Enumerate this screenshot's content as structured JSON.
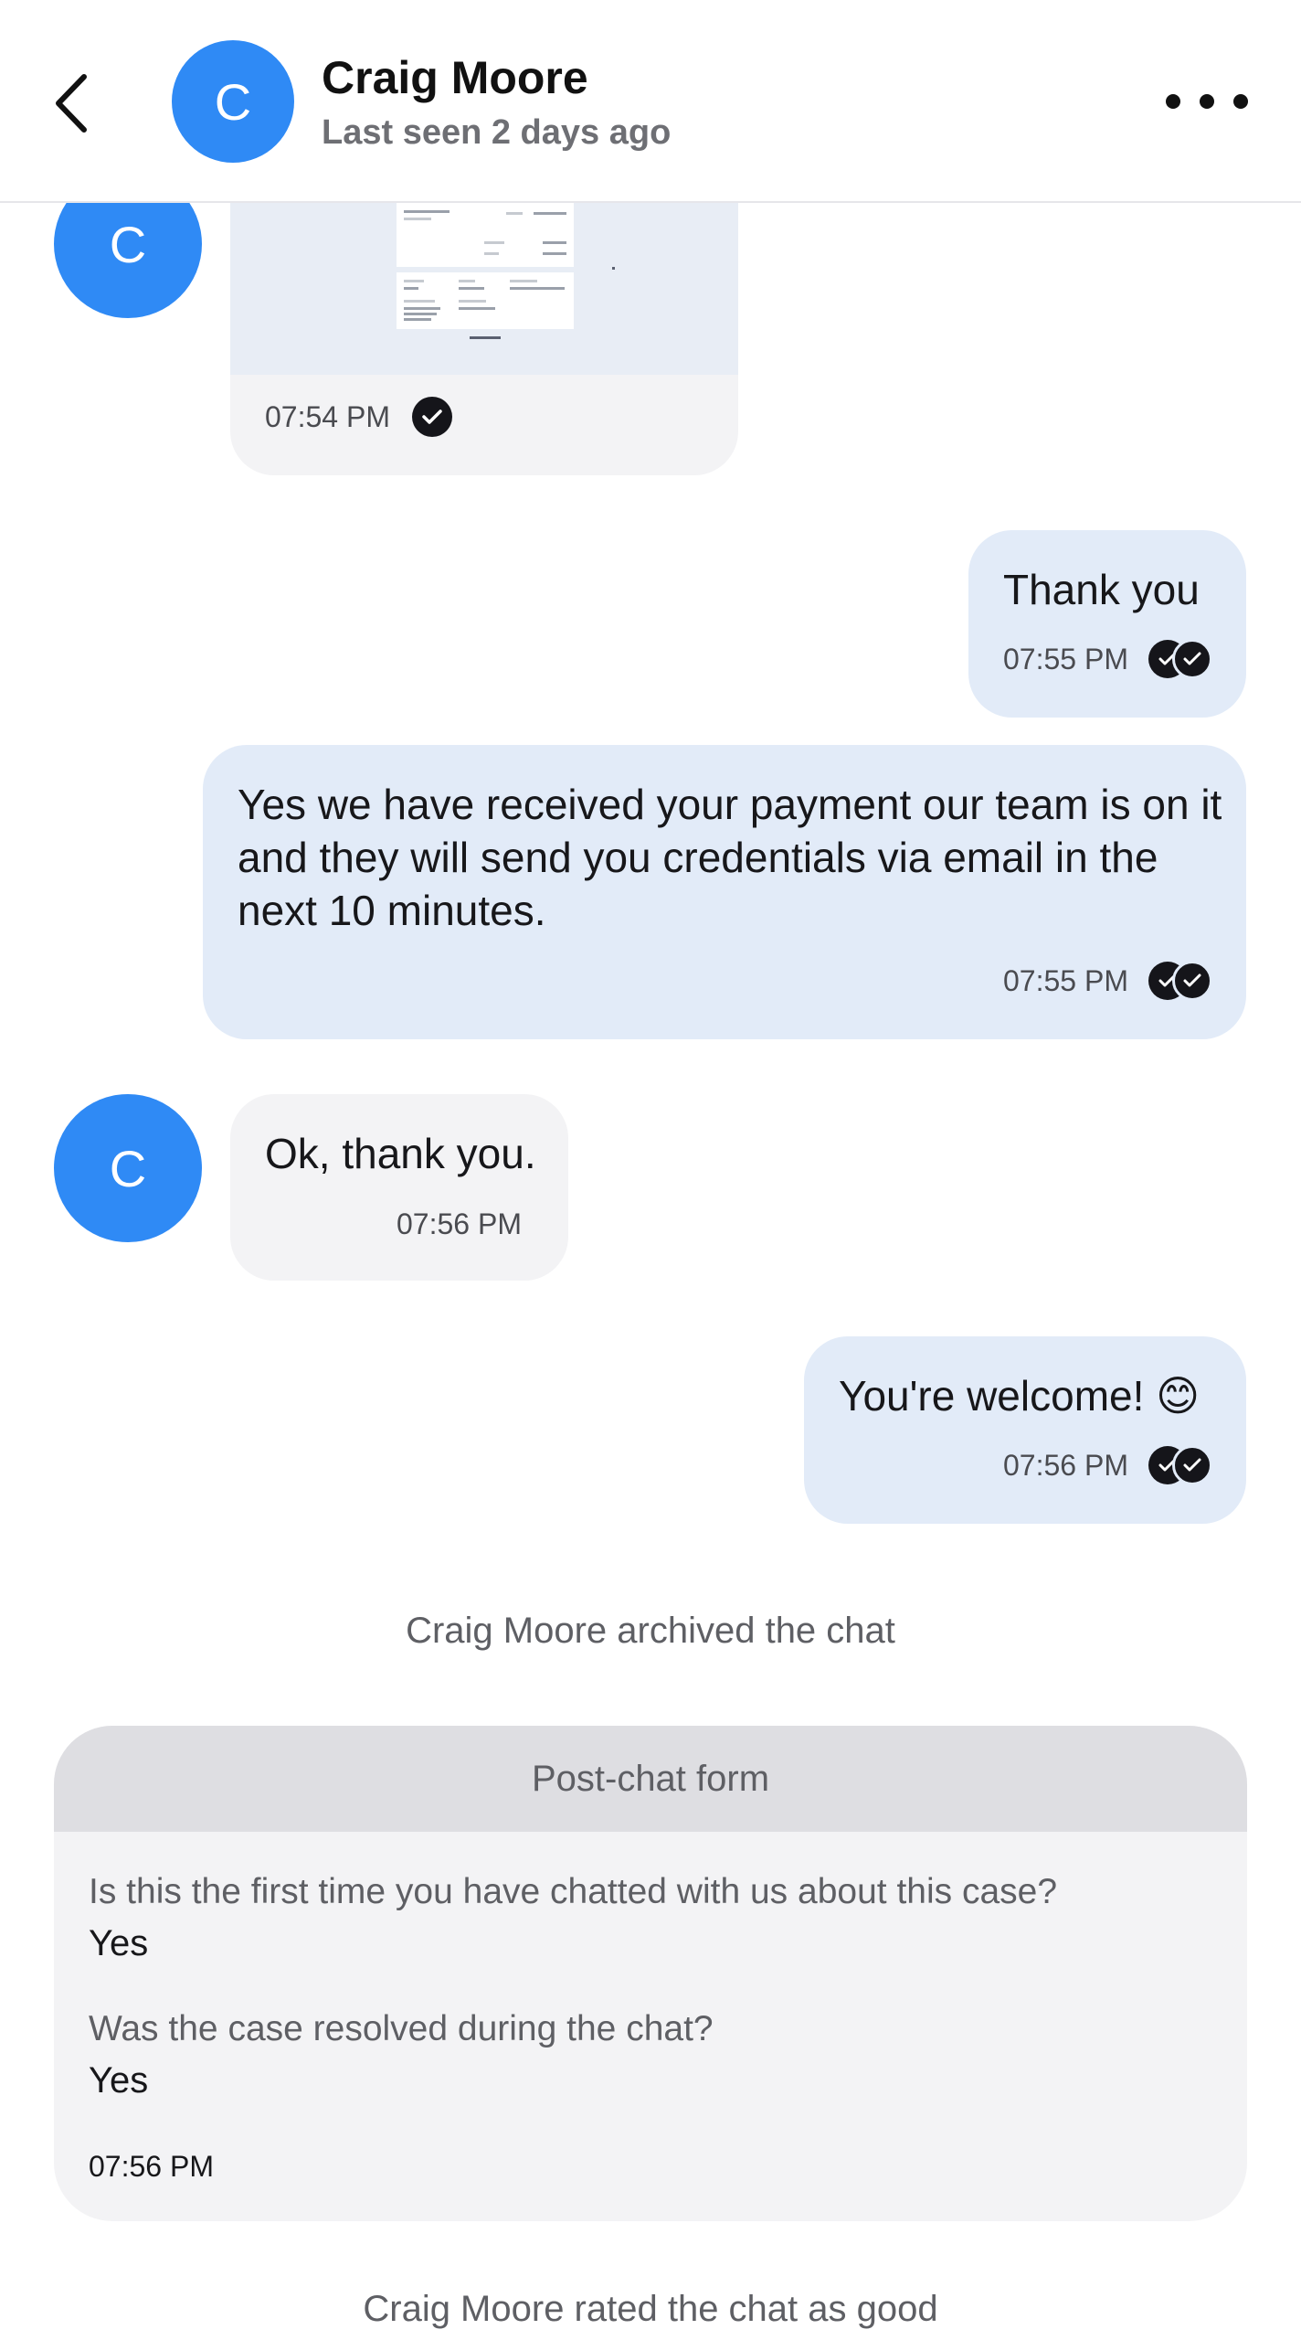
{
  "header": {
    "contact_name": "Craig Moore",
    "contact_status": "Last seen 2 days ago",
    "avatar_initial": "C",
    "back_icon": "chevron-left-icon",
    "more_icon": "more-horizontal-icon"
  },
  "colors": {
    "avatar": "#2f8af5",
    "outgoing_bubble": "#e2ebf8",
    "incoming_bubble": "#f3f3f5"
  },
  "messages": [
    {
      "direction": "in",
      "type": "attachment",
      "time": "07:54 PM",
      "status": "sent"
    },
    {
      "direction": "out",
      "text": "Thank you",
      "time": "07:55 PM",
      "status": "read"
    },
    {
      "direction": "out",
      "text": "Yes we have received your payment our team is on it and they will send you credentials via email in the next 10 minutes.",
      "time": "07:55 PM",
      "status": "read"
    },
    {
      "direction": "in",
      "text": "Ok, thank you.",
      "time": "07:56 PM"
    },
    {
      "direction": "out",
      "text": "You're welcome! 😊",
      "time": "07:56 PM",
      "status": "read"
    }
  ],
  "system": {
    "archived": "Craig Moore archived the chat",
    "rated": "Craig Moore rated the chat as good"
  },
  "post_chat_form": {
    "title": "Post-chat form",
    "items": [
      {
        "question": "Is this the first time you have chatted with us about this case?",
        "answer": "Yes"
      },
      {
        "question": "Was the case resolved during the chat?",
        "answer": "Yes"
      }
    ],
    "time": "07:56 PM"
  }
}
